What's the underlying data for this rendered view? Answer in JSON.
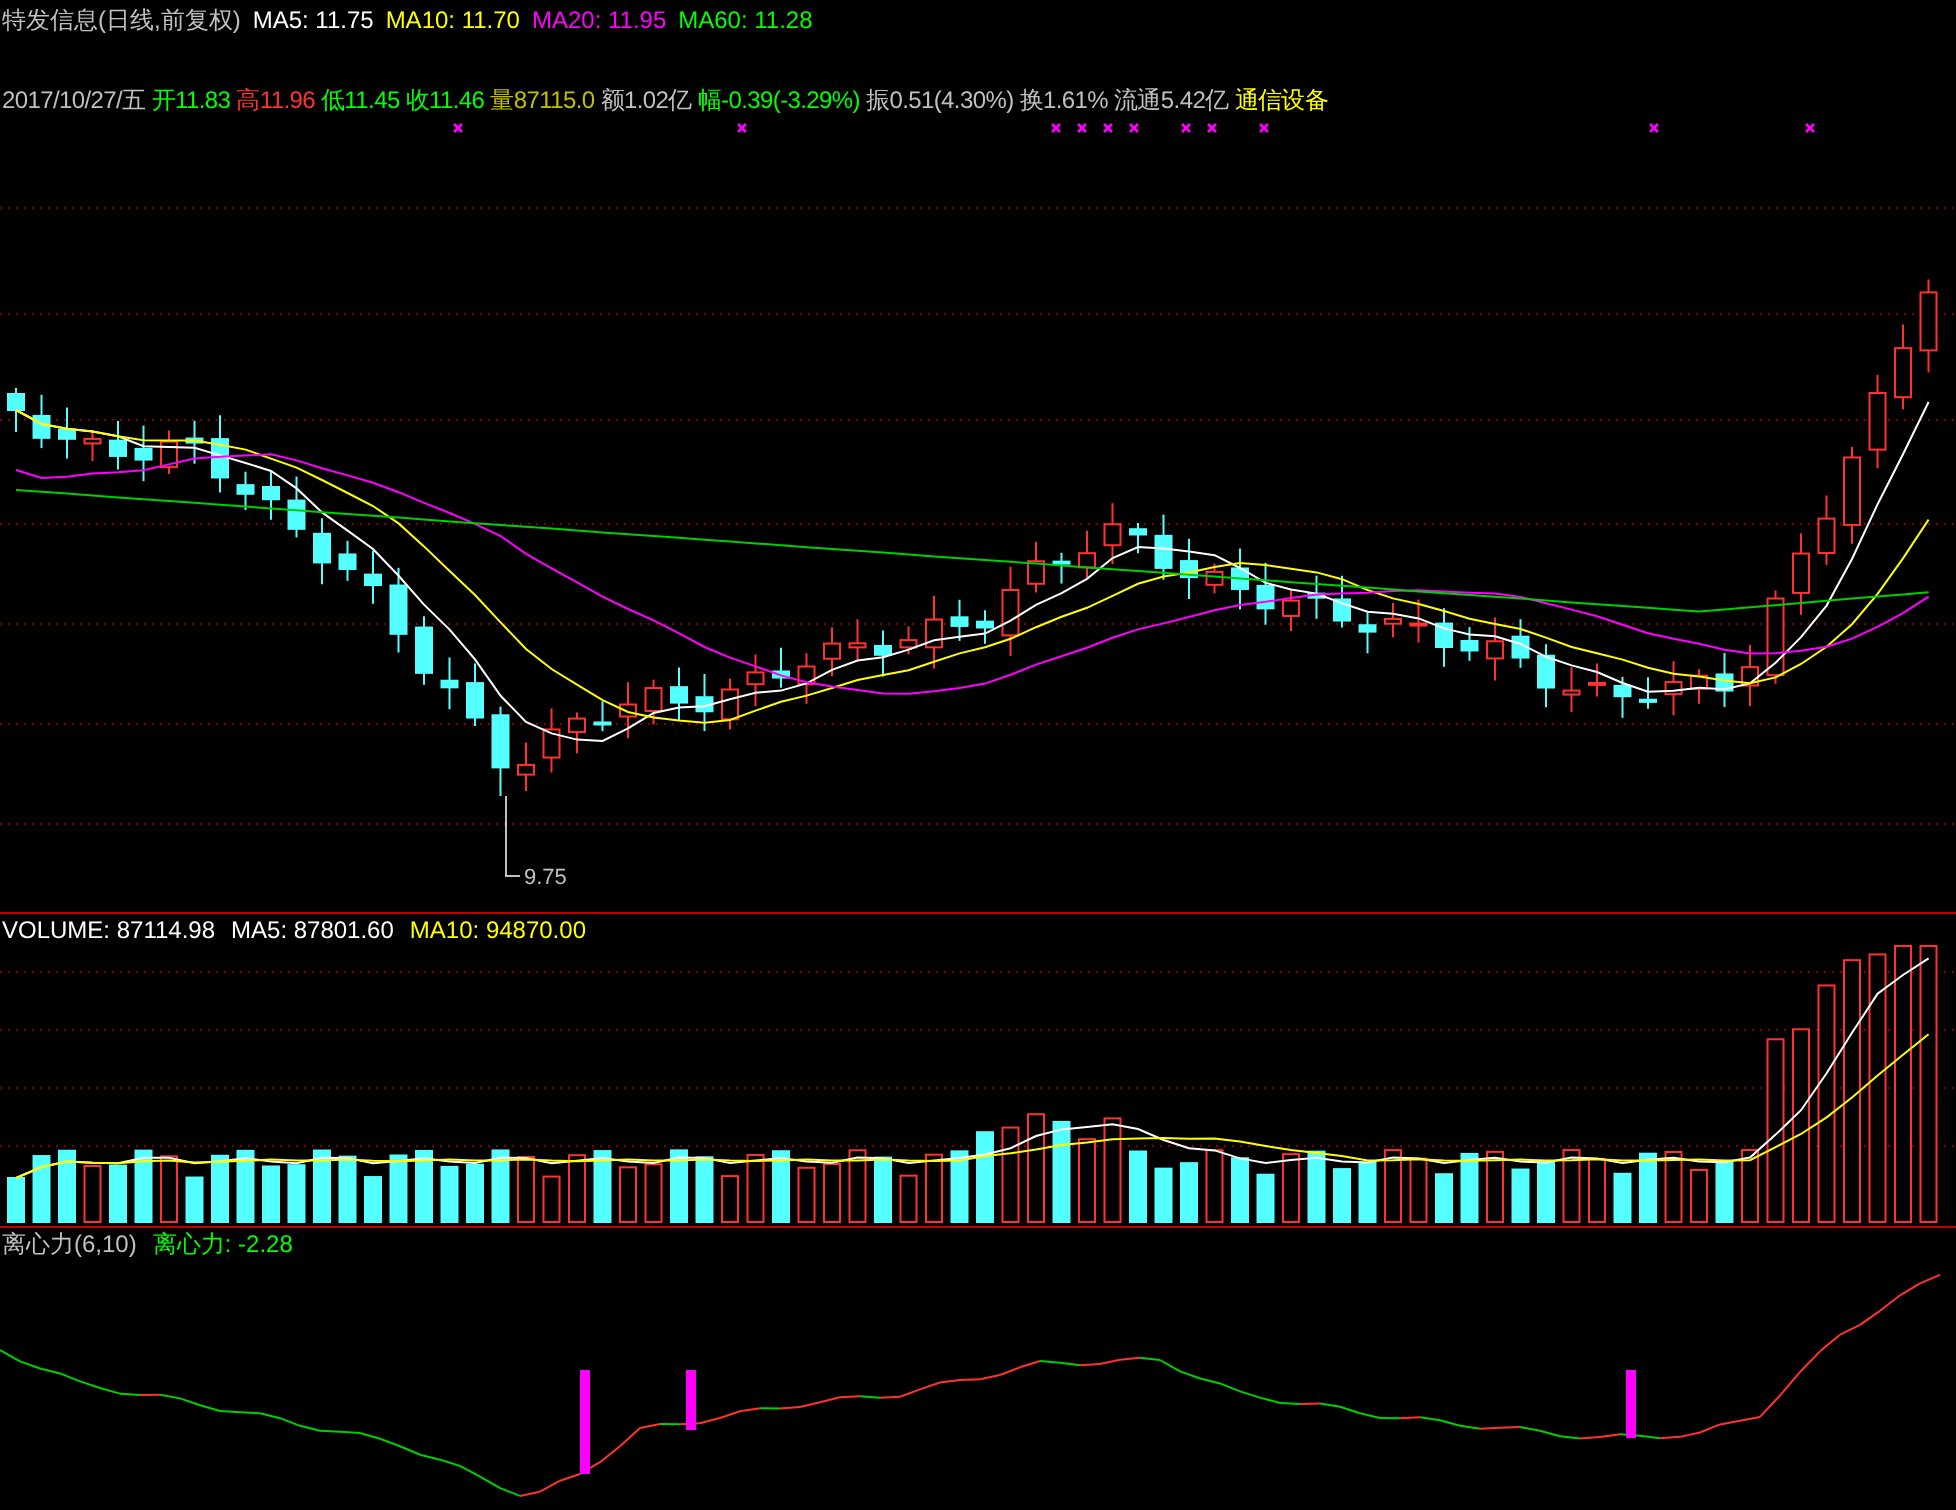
{
  "title": {
    "text": "特发信息(日线,前复权)"
  },
  "ma_legend": [
    {
      "label": "MA5: 11.75",
      "color": "#ffffff"
    },
    {
      "label": "MA10: 11.70",
      "color": "#ffff00"
    },
    {
      "label": "MA20: 11.95",
      "color": "#ff00ff"
    },
    {
      "label": "MA60: 11.28",
      "color": "#00ff00"
    }
  ],
  "quote": [
    {
      "text": "2017/10/27/五",
      "color": "#c0c0c0"
    },
    {
      "text": "开11.83",
      "color": "#00ff00"
    },
    {
      "text": "高11.96",
      "color": "#ff3232"
    },
    {
      "text": "低11.45",
      "color": "#00ff00"
    },
    {
      "text": "收11.46",
      "color": "#00ff00"
    },
    {
      "text": "量87115.0",
      "color": "#c0c000"
    },
    {
      "text": "额1.02亿",
      "color": "#c0c0c0"
    },
    {
      "text": "幅-0.39(-3.29%)",
      "color": "#00ff00"
    },
    {
      "text": "振0.51(4.30%)",
      "color": "#c0c0c0"
    },
    {
      "text": "换1.61%",
      "color": "#c0c0c0"
    },
    {
      "text": "流通5.42亿",
      "color": "#c0c0c0"
    },
    {
      "text": "通信设备",
      "color": "#ffff00"
    }
  ],
  "price_chart": {
    "low_label": "9.75"
  },
  "volume": {
    "legend": [
      {
        "label": "VOLUME: 87114.98",
        "color": "#ffffff"
      },
      {
        "label": "MA5: 87801.60",
        "color": "#ffffff"
      },
      {
        "label": "MA10: 94870.00",
        "color": "#ffff00"
      }
    ]
  },
  "indicator": {
    "title": "离心力(6,10)",
    "legend": [
      {
        "label": "离心力: -2.28",
        "color": "#00ff00"
      }
    ]
  }
}
